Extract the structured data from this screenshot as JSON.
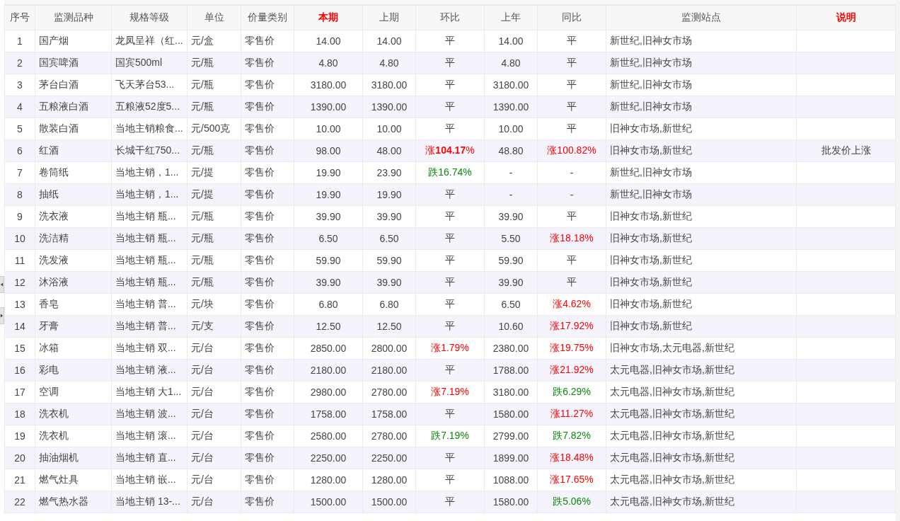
{
  "table": {
    "columns": [
      {
        "label": "序号",
        "highlight": false
      },
      {
        "label": "监测品种",
        "highlight": false
      },
      {
        "label": "规格等级",
        "highlight": false
      },
      {
        "label": "单位",
        "highlight": false
      },
      {
        "label": "价量类别",
        "highlight": false
      },
      {
        "label": "本期",
        "highlight": true
      },
      {
        "label": "上期",
        "highlight": false
      },
      {
        "label": "环比",
        "highlight": false
      },
      {
        "label": "上年",
        "highlight": false
      },
      {
        "label": "同比",
        "highlight": false
      },
      {
        "label": "监测站点",
        "highlight": false
      },
      {
        "label": "说明",
        "highlight": true
      }
    ],
    "rows": [
      {
        "no": "1",
        "item": "国产烟",
        "spec": "龙凤呈祥（红...",
        "unit": "元/盒",
        "price_type": "零售价",
        "current": "14.00",
        "previous": "14.00",
        "mom": {
          "text": "平",
          "kind": "flat"
        },
        "last_year": "14.00",
        "yoy": {
          "text": "平",
          "kind": "flat"
        },
        "stations": "新世纪,旧神女市场"
      },
      {
        "no": "2",
        "item": "国宾啤酒",
        "spec": "国宾500ml",
        "unit": "元/瓶",
        "price_type": "零售价",
        "current": "4.80",
        "previous": "4.80",
        "mom": {
          "text": "平",
          "kind": "flat"
        },
        "last_year": "4.80",
        "yoy": {
          "text": "平",
          "kind": "flat"
        },
        "stations": "新世纪,旧神女市场"
      },
      {
        "no": "3",
        "item": "茅台白酒",
        "spec": "飞天茅台53...",
        "unit": "元/瓶",
        "price_type": "零售价",
        "current": "3180.00",
        "previous": "3180.00",
        "mom": {
          "text": "平",
          "kind": "flat"
        },
        "last_year": "3180.00",
        "yoy": {
          "text": "平",
          "kind": "flat"
        },
        "stations": "新世纪,旧神女市场"
      },
      {
        "no": "4",
        "item": "五粮液白酒",
        "spec": "五粮液52度5...",
        "unit": "元/瓶",
        "price_type": "零售价",
        "current": "1390.00",
        "previous": "1390.00",
        "mom": {
          "text": "平",
          "kind": "flat"
        },
        "last_year": "1390.00",
        "yoy": {
          "text": "平",
          "kind": "flat"
        },
        "stations": "新世纪,旧神女市场"
      },
      {
        "no": "5",
        "item": "散装白酒",
        "spec": "当地主销粮食...",
        "unit": "元/500克",
        "price_type": "零售价",
        "current": "10.00",
        "previous": "10.00",
        "mom": {
          "text": "平",
          "kind": "flat"
        },
        "last_year": "10.00",
        "yoy": {
          "text": "平",
          "kind": "flat"
        },
        "stations": "旧神女市场,新世纪"
      },
      {
        "no": "6",
        "item": "红酒",
        "spec": "长城干红750...",
        "unit": "元/瓶",
        "price_type": "零售价",
        "current": "98.00",
        "previous": "48.00",
        "mom": {
          "text": "涨**104.17**%",
          "kind": "up"
        },
        "last_year": "48.80",
        "yoy": {
          "text": "涨100.82%",
          "kind": "up"
        },
        "stations": "旧神女市场,新世纪",
        "note": "批发价上涨"
      },
      {
        "no": "7",
        "item": "卷筒纸",
        "spec": "当地主销，1...",
        "unit": "元/提",
        "price_type": "零售价",
        "current": "19.90",
        "previous": "23.90",
        "mom": {
          "text": "跌16.74%",
          "kind": "down"
        },
        "last_year": "-",
        "yoy": {
          "text": "-",
          "kind": "flat"
        },
        "stations": "新世纪,旧神女市场"
      },
      {
        "no": "8",
        "item": "抽纸",
        "spec": "当地主销，1...",
        "unit": "元/提",
        "price_type": "零售价",
        "current": "19.90",
        "previous": "19.90",
        "mom": {
          "text": "平",
          "kind": "flat"
        },
        "last_year": "-",
        "yoy": {
          "text": "-",
          "kind": "flat"
        },
        "stations": "新世纪,旧神女市场"
      },
      {
        "no": "9",
        "item": "洗衣液",
        "spec": "当地主销 瓶...",
        "unit": "元/瓶",
        "price_type": "零售价",
        "current": "39.90",
        "previous": "39.90",
        "mom": {
          "text": "平",
          "kind": "flat"
        },
        "last_year": "39.90",
        "yoy": {
          "text": "平",
          "kind": "flat"
        },
        "stations": "旧神女市场,新世纪"
      },
      {
        "no": "10",
        "item": "洗洁精",
        "spec": "当地主销 瓶...",
        "unit": "元/瓶",
        "price_type": "零售价",
        "current": "6.50",
        "previous": "6.50",
        "mom": {
          "text": "平",
          "kind": "flat"
        },
        "last_year": "5.50",
        "yoy": {
          "text": "涨18.18%",
          "kind": "up"
        },
        "stations": "旧神女市场,新世纪"
      },
      {
        "no": "11",
        "item": "洗发液",
        "spec": "当地主销 瓶...",
        "unit": "元/瓶",
        "price_type": "零售价",
        "current": "59.90",
        "previous": "59.90",
        "mom": {
          "text": "平",
          "kind": "flat"
        },
        "last_year": "59.90",
        "yoy": {
          "text": "平",
          "kind": "flat"
        },
        "stations": "旧神女市场,新世纪"
      },
      {
        "no": "12",
        "item": "沐浴液",
        "spec": "当地主销 瓶...",
        "unit": "元/瓶",
        "price_type": "零售价",
        "current": "39.90",
        "previous": "39.90",
        "mom": {
          "text": "平",
          "kind": "flat"
        },
        "last_year": "39.90",
        "yoy": {
          "text": "平",
          "kind": "flat"
        },
        "stations": "旧神女市场,新世纪"
      },
      {
        "no": "13",
        "item": "香皂",
        "spec": "当地主销 普...",
        "unit": "元/块",
        "price_type": "零售价",
        "current": "6.80",
        "previous": "6.80",
        "mom": {
          "text": "平",
          "kind": "flat"
        },
        "last_year": "6.50",
        "yoy": {
          "text": "涨4.62%",
          "kind": "up"
        },
        "stations": "旧神女市场,新世纪"
      },
      {
        "no": "14",
        "item": "牙膏",
        "spec": "当地主销 普...",
        "unit": "元/支",
        "price_type": "零售价",
        "current": "12.50",
        "previous": "12.50",
        "mom": {
          "text": "平",
          "kind": "flat"
        },
        "last_year": "10.60",
        "yoy": {
          "text": "涨17.92%",
          "kind": "up"
        },
        "stations": "旧神女市场,新世纪"
      },
      {
        "no": "15",
        "item": "冰箱",
        "spec": "当地主销 双...",
        "unit": "元/台",
        "price_type": "零售价",
        "current": "2850.00",
        "previous": "2800.00",
        "mom": {
          "text": "涨1.79%",
          "kind": "up"
        },
        "last_year": "2380.00",
        "yoy": {
          "text": "涨19.75%",
          "kind": "up"
        },
        "stations": "旧神女市场,太元电器,新世纪"
      },
      {
        "no": "16",
        "item": "彩电",
        "spec": "当地主销 液...",
        "unit": "元/台",
        "price_type": "零售价",
        "current": "2180.00",
        "previous": "2180.00",
        "mom": {
          "text": "平",
          "kind": "flat"
        },
        "last_year": "1788.00",
        "yoy": {
          "text": "涨21.92%",
          "kind": "up"
        },
        "stations": "太元电器,旧神女市场,新世纪"
      },
      {
        "no": "17",
        "item": "空调",
        "spec": "当地主销 大1...",
        "unit": "元/台",
        "price_type": "零售价",
        "current": "2980.00",
        "previous": "2780.00",
        "mom": {
          "text": "涨7.19%",
          "kind": "up"
        },
        "last_year": "3180.00",
        "yoy": {
          "text": "跌6.29%",
          "kind": "down"
        },
        "stations": "太元电器,旧神女市场,新世纪"
      },
      {
        "no": "18",
        "item": "洗衣机",
        "spec": "当地主销 波...",
        "unit": "元/台",
        "price_type": "零售价",
        "current": "1758.00",
        "previous": "1758.00",
        "mom": {
          "text": "平",
          "kind": "flat"
        },
        "last_year": "1580.00",
        "yoy": {
          "text": "涨11.27%",
          "kind": "up"
        },
        "stations": "太元电器,旧神女市场,新世纪"
      },
      {
        "no": "19",
        "item": "洗衣机",
        "spec": "当地主销 滚...",
        "unit": "元/台",
        "price_type": "零售价",
        "current": "2580.00",
        "previous": "2780.00",
        "mom": {
          "text": "跌7.19%",
          "kind": "down"
        },
        "last_year": "2799.00",
        "yoy": {
          "text": "跌7.82%",
          "kind": "down"
        },
        "stations": "太元电器,旧神女市场,新世纪"
      },
      {
        "no": "20",
        "item": "抽油烟机",
        "spec": "当地主销 直...",
        "unit": "元/台",
        "price_type": "零售价",
        "current": "2250.00",
        "previous": "2250.00",
        "mom": {
          "text": "平",
          "kind": "flat"
        },
        "last_year": "1899.00",
        "yoy": {
          "text": "涨18.48%",
          "kind": "up"
        },
        "stations": "太元电器,旧神女市场,新世纪"
      },
      {
        "no": "21",
        "item": "燃气灶具",
        "spec": "当地主销 嵌...",
        "unit": "元/台",
        "price_type": "零售价",
        "current": "1280.00",
        "previous": "1280.00",
        "mom": {
          "text": "平",
          "kind": "flat"
        },
        "last_year": "1088.00",
        "yoy": {
          "text": "涨17.65%",
          "kind": "up"
        },
        "stations": "太元电器,旧神女市场,新世纪"
      },
      {
        "no": "22",
        "item": "燃气热水器",
        "spec": "当地主销 13-...",
        "unit": "元/台",
        "price_type": "零售价",
        "current": "1500.00",
        "previous": "1500.00",
        "mom": {
          "text": "平",
          "kind": "flat"
        },
        "last_year": "1580.00",
        "yoy": {
          "text": "跌5.06%",
          "kind": "down"
        },
        "stations": "太元电器,旧神女市场,新世纪"
      }
    ]
  }
}
